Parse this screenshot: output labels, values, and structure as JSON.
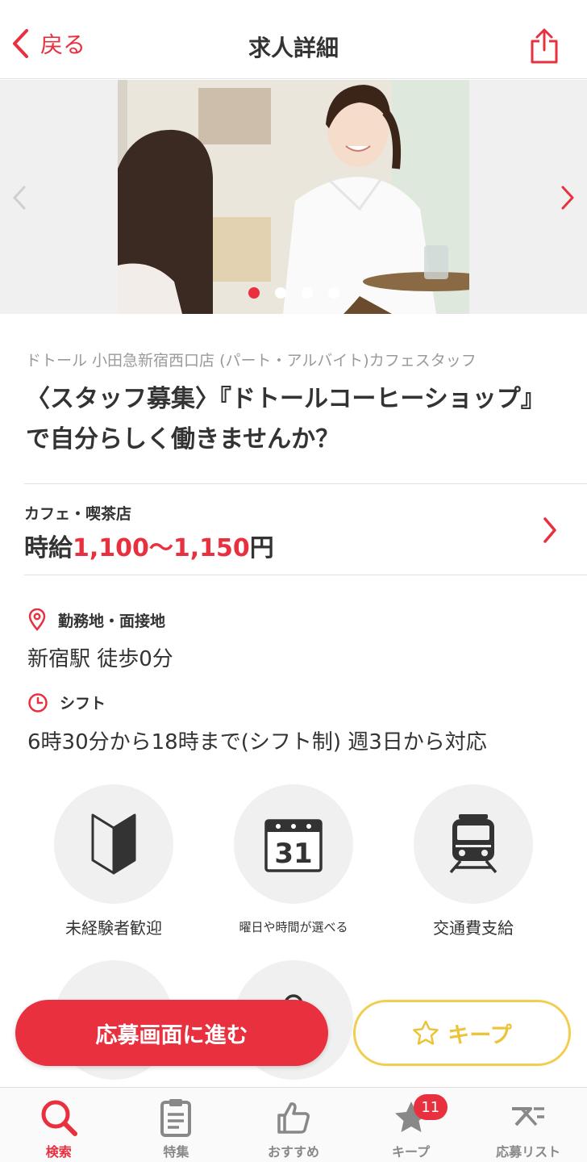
{
  "header": {
    "back_label": "戻る",
    "title": "求人詳細"
  },
  "carousel": {
    "slide_count": 4,
    "active_index": 0
  },
  "job": {
    "company": "ドトール 小田急新宿西口店 (パート・アルバイト)カフェスタッフ",
    "headline": "〈スタッフ募集〉『ドトールコーヒーショップ』で自分らしく働きませんか？",
    "category": "カフェ・喫茶店",
    "wage_prefix": "時給",
    "wage_range": "1,100〜1,150",
    "wage_suffix": "円"
  },
  "info": {
    "location_label": "勤務地・面接地",
    "location_value": "新宿駅 徒歩0分",
    "shift_label": "シフト",
    "shift_value": "6時30分から18時まで(シフト制) 週3日から対応"
  },
  "features": [
    {
      "label": "未経験者歓迎",
      "icon": "beginner-mark-icon"
    },
    {
      "label": "曜日や時間が選べる",
      "icon": "calendar-icon",
      "calendar_day": "31"
    },
    {
      "label": "交通費支給",
      "icon": "train-icon"
    }
  ],
  "actions": {
    "apply_label": "応募画面に進む",
    "keep_label": "キープ"
  },
  "tabbar": {
    "items": [
      {
        "label": "検索",
        "icon": "search-icon",
        "active": true
      },
      {
        "label": "特集",
        "icon": "clipboard-icon"
      },
      {
        "label": "おすすめ",
        "icon": "thumbs-up-icon"
      },
      {
        "label": "キープ",
        "icon": "star-icon",
        "badge": "11"
      },
      {
        "label": "応募リスト",
        "icon": "apply-list-icon"
      }
    ]
  },
  "colors": {
    "accent": "#e8303f",
    "keep": "#f2cd4f",
    "icon_gray": "#888888"
  }
}
